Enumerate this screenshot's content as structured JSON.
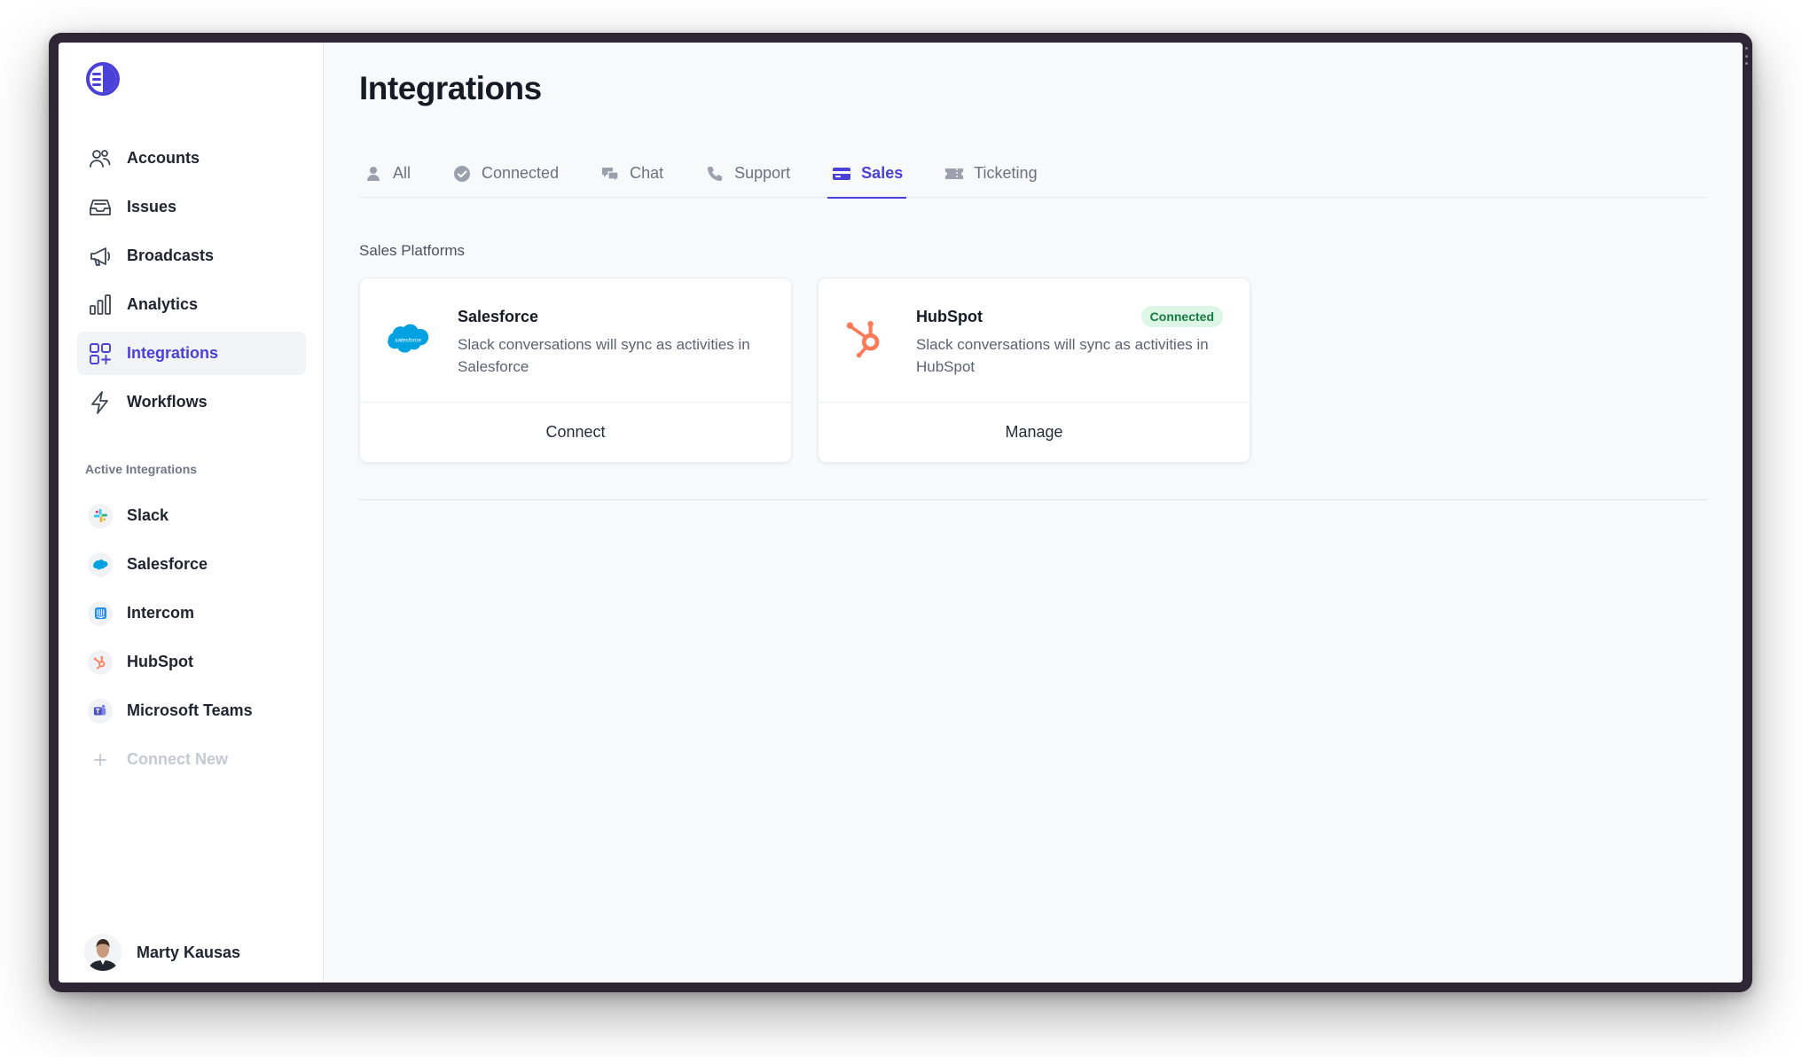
{
  "app": {
    "page_title": "Integrations",
    "accent_color": "#4a41d8"
  },
  "sidebar": {
    "logo_icon": "logo-icon",
    "nav": [
      {
        "label": "Accounts",
        "icon": "users-icon",
        "active": false
      },
      {
        "label": "Issues",
        "icon": "inbox-icon",
        "active": false
      },
      {
        "label": "Broadcasts",
        "icon": "megaphone-icon",
        "active": false
      },
      {
        "label": "Analytics",
        "icon": "bar-chart-icon",
        "active": false
      },
      {
        "label": "Integrations",
        "icon": "grid-plus-icon",
        "active": true
      },
      {
        "label": "Workflows",
        "icon": "lightning-icon",
        "active": false
      }
    ],
    "section_label": "Active Integrations",
    "active_integrations": [
      {
        "label": "Slack",
        "icon": "slack-icon"
      },
      {
        "label": "Salesforce",
        "icon": "salesforce-icon"
      },
      {
        "label": "Intercom",
        "icon": "intercom-icon"
      },
      {
        "label": "HubSpot",
        "icon": "hubspot-icon"
      },
      {
        "label": "Microsoft Teams",
        "icon": "teams-icon"
      }
    ],
    "connect_new": "Connect New",
    "user": {
      "name": "Marty Kausas"
    }
  },
  "tabs": [
    {
      "label": "All",
      "icon": "person-icon",
      "active": false
    },
    {
      "label": "Connected",
      "icon": "check-circle-icon",
      "active": false
    },
    {
      "label": "Chat",
      "icon": "chat-bubbles-icon",
      "active": false
    },
    {
      "label": "Support",
      "icon": "phone-icon",
      "active": false
    },
    {
      "label": "Sales",
      "icon": "credit-card-icon",
      "active": true
    },
    {
      "label": "Ticketing",
      "icon": "ticket-icon",
      "active": false
    }
  ],
  "section": {
    "heading": "Sales Platforms",
    "cards": [
      {
        "title": "Salesforce",
        "description": "Slack conversations will sync as activities in Salesforce",
        "logo_text": "salesforce",
        "action": "Connect",
        "status": ""
      },
      {
        "title": "HubSpot",
        "description": "Slack conversations will sync as activities in HubSpot",
        "action": "Manage",
        "status": "Connected"
      }
    ]
  }
}
